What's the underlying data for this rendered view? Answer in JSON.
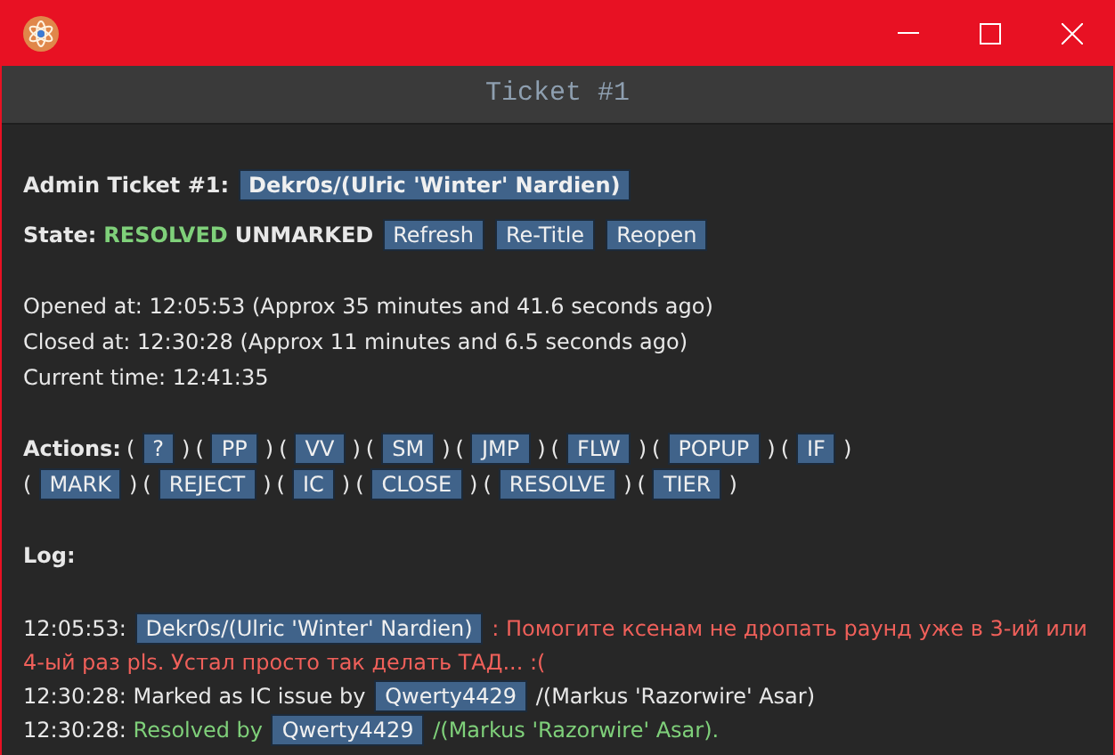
{
  "window": {
    "title": "Ticket #1"
  },
  "ticket": {
    "label": "Admin Ticket #1:",
    "player": "Dekr0s/(Ulric 'Winter' Nardien)"
  },
  "state": {
    "label": "State:",
    "status": "RESOLVED",
    "mark": "UNMARKED",
    "buttons": [
      "Refresh",
      "Re-Title",
      "Reopen"
    ]
  },
  "times": [
    "Opened at: 12:05:53 (Approx 35 minutes and 41.6 seconds ago)",
    "Closed at: 12:30:28 (Approx 11 minutes and 6.5 seconds ago)",
    "Current time: 12:41:35"
  ],
  "actions_label": "Actions:",
  "actions": [
    [
      {
        "before": "(",
        "label": "?",
        "after": ")"
      },
      {
        "before": "(",
        "label": "PP",
        "after": ")"
      },
      {
        "before": "(",
        "label": "VV",
        "after": ")"
      },
      {
        "before": "(",
        "label": "SM",
        "after": ")"
      },
      {
        "before": "(",
        "label": "JMP",
        "after": ")"
      },
      {
        "before": "(",
        "label": "FLW",
        "after": ")"
      },
      {
        "before": "(",
        "label": "POPUP",
        "after": ")"
      },
      {
        "before": "(",
        "label": "IF",
        "after": ")"
      }
    ],
    [
      {
        "before": "(",
        "label": "MARK",
        "after": ")"
      },
      {
        "before": "(",
        "label": "REJECT",
        "after": ")"
      },
      {
        "before": "(",
        "label": "IC",
        "after": ")"
      },
      {
        "before": "(",
        "label": "CLOSE",
        "after": ")"
      },
      {
        "before": "(",
        "label": "RESOLVE",
        "after": ")"
      },
      {
        "before": "(",
        "label": "TIER",
        "after": ")"
      }
    ]
  ],
  "log_label": "Log:",
  "log": [
    {
      "time": "12:05:53:",
      "kind": "message",
      "user": "Dekr0s/(Ulric 'Winter' Nardien)",
      "post": ": Помогите ксенам не дропать раунд уже в 3-ий или 4-ый раз pls. Устал просто так делать ТАД... :("
    },
    {
      "time": "12:30:28:",
      "kind": "note",
      "pre": "Marked as IC issue by",
      "user": "Qwerty4429",
      "post": "/(Markus 'Razorwire' Asar)"
    },
    {
      "time": "12:30:28:",
      "kind": "resolved",
      "pre": "Resolved by",
      "user": "Qwerty4429",
      "post": "/(Markus 'Razorwire' Asar)."
    }
  ]
}
